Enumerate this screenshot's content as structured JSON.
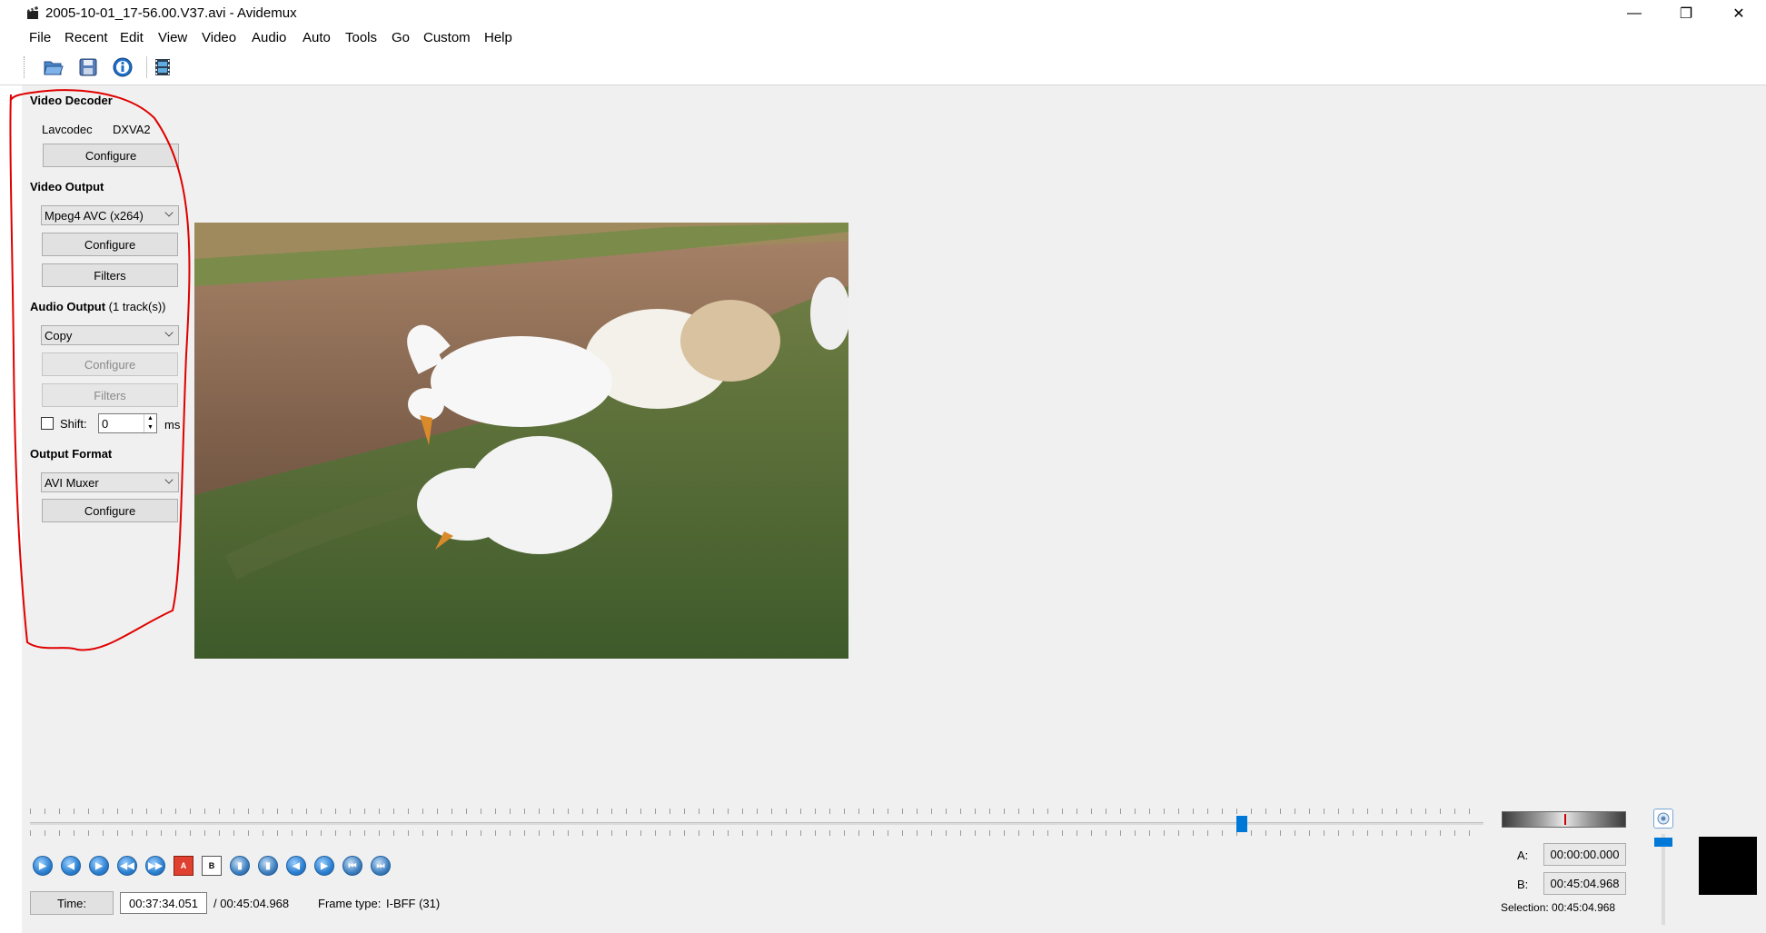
{
  "window": {
    "title": "2005-10-01_17-56.00.V37.avi - Avidemux",
    "minimize": "—",
    "maximize": "❐",
    "close": "✕"
  },
  "menu": [
    "File",
    "Recent",
    "Edit",
    "View",
    "Video",
    "Audio",
    "Auto",
    "Tools",
    "Go",
    "Custom",
    "Help"
  ],
  "toolbar": {
    "icons": [
      "open-icon",
      "save-icon",
      "info-icon",
      "film-properties-icon"
    ]
  },
  "video_decoder": {
    "heading": "Video Decoder",
    "codec": "Lavcodec",
    "hw": "DXVA2",
    "configure": "Configure"
  },
  "video_output": {
    "heading": "Video Output",
    "codec": "Mpeg4 AVC (x264)",
    "configure": "Configure",
    "filters": "Filters"
  },
  "audio_output": {
    "heading": "Audio Output",
    "tracks": "(1 track(s))",
    "codec": "Copy",
    "configure": "Configure",
    "filters": "Filters",
    "shift_label": "Shift:",
    "shift_value": "0",
    "shift_unit": "ms"
  },
  "output_format": {
    "heading": "Output Format",
    "muxer": "AVI Muxer",
    "configure": "Configure"
  },
  "timeline": {
    "position_fraction": 0.834
  },
  "time_bar": {
    "time_label": "Time:",
    "current": "00:37:34.051",
    "total": "/ 00:45:04.968",
    "frame_type_label": "Frame type:",
    "frame_type": "I-BFF (31)"
  },
  "selection": {
    "a_label": "A:",
    "a_value": "00:00:00.000",
    "b_label": "B:",
    "b_value": "00:45:04.968",
    "selection_text": "Selection: 00:45:04.968"
  },
  "colors": {
    "accent": "#0078d7",
    "annotation": "#e00000",
    "background": "#f0f0f0"
  }
}
